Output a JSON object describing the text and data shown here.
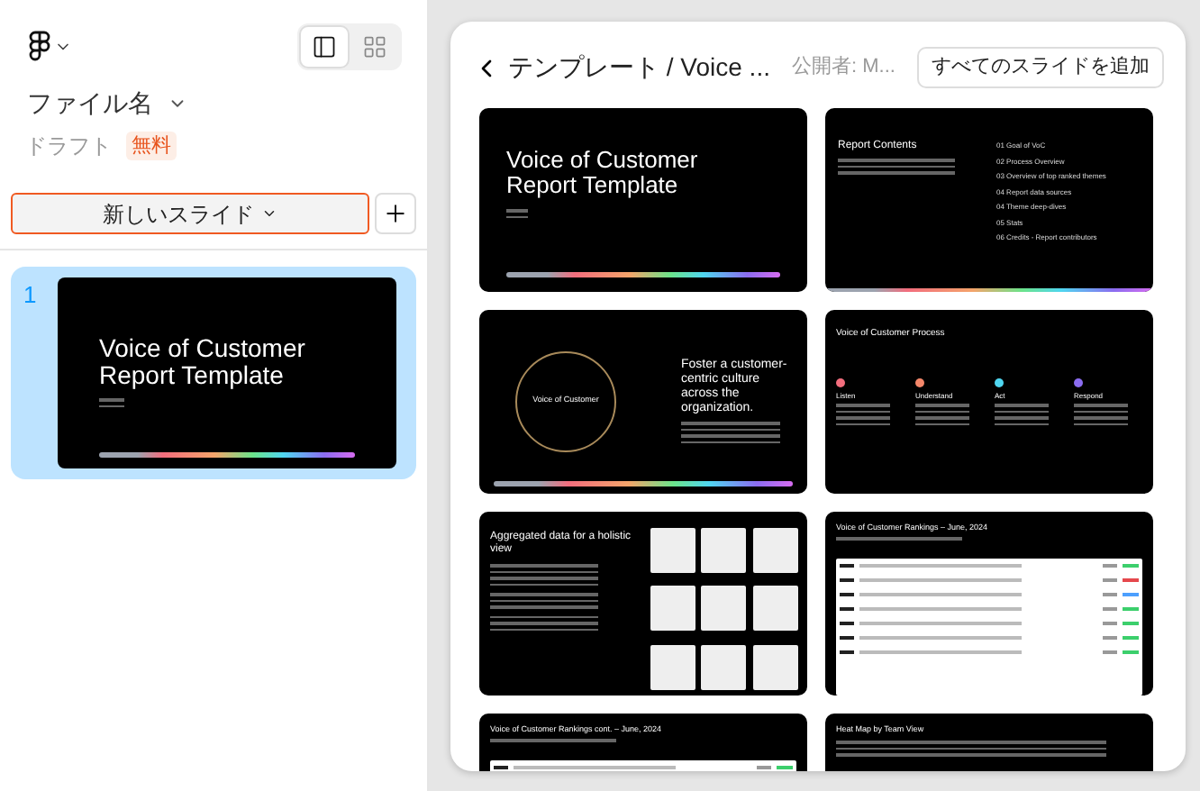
{
  "sidebar": {
    "file_name": "ファイル名",
    "status": "ドラフト",
    "badge": "無料",
    "view_toggle": [
      {
        "kind": "panel",
        "selected": true
      },
      {
        "kind": "grid",
        "selected": false
      }
    ],
    "new_slide_button": "新しいスライド",
    "slides": [
      {
        "number": "1",
        "selected": true,
        "title": "Voice of Customer Report Template"
      }
    ]
  },
  "template_browser": {
    "breadcrumb": "テンプレート / Voice ...",
    "publisher": "公開者: M...",
    "add_all_button": "すべてのスライドを追加",
    "slides": [
      {
        "kind": "title",
        "title": "Voice of Customer Report Template"
      },
      {
        "kind": "contents",
        "title": "Report Contents",
        "items": [
          "01 Goal of VoC",
          "02 Process Overview",
          "03 Overview of top ranked themes",
          "04 Report data sources",
          "04 Theme deep-dives",
          "05 Stats",
          "06 Credits - Report contributors"
        ]
      },
      {
        "kind": "circle",
        "title": "Foster a customer-centric culture across the organization.",
        "center": "Voice of Customer"
      },
      {
        "kind": "process",
        "title": "Voice of Customer Process",
        "steps": [
          {
            "label": "Listen",
            "color": "#f26d7d"
          },
          {
            "label": "Understand",
            "color": "#f4876a"
          },
          {
            "label": "Act",
            "color": "#4fd6f0"
          },
          {
            "label": "Respond",
            "color": "#8b6cf0"
          }
        ]
      },
      {
        "kind": "grid",
        "title": "Aggregated data for a holistic view"
      },
      {
        "kind": "table",
        "title": "Voice of Customer Rankings – June, 2024"
      },
      {
        "kind": "table",
        "title": "Voice of Customer Rankings cont. – June, 2024"
      },
      {
        "kind": "heatmap",
        "title": "Heat Map by Team View"
      }
    ]
  }
}
